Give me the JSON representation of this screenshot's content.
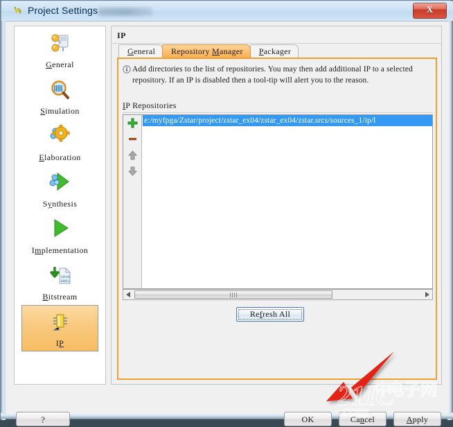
{
  "window": {
    "title": "Project Settings",
    "icon": "vivado-logo-icon",
    "close_label": "X"
  },
  "sidebar": {
    "items": [
      {
        "label_pre": "",
        "label_u": "G",
        "label_post": "eneral",
        "label": "General",
        "icon": "general-icon",
        "selected": false
      },
      {
        "label_pre": "",
        "label_u": "S",
        "label_post": "imulation",
        "label": "Simulation",
        "icon": "simulation-icon",
        "selected": false
      },
      {
        "label_pre": "",
        "label_u": "E",
        "label_post": "laboration",
        "label": "Elaboration",
        "icon": "elaboration-icon",
        "selected": false
      },
      {
        "label_pre": "S",
        "label_u": "y",
        "label_post": "nthesis",
        "label": "Synthesis",
        "icon": "synthesis-icon",
        "selected": false
      },
      {
        "label_pre": "I",
        "label_u": "m",
        "label_post": "plementation",
        "label": "Implementation",
        "icon": "implementation-icon",
        "selected": false
      },
      {
        "label_pre": "",
        "label_u": "B",
        "label_post": "itstream",
        "label": "Bitstream",
        "icon": "bitstream-icon",
        "selected": false
      },
      {
        "label_pre": "I",
        "label_u": "P",
        "label_post": "",
        "label": "IP",
        "icon": "ip-chip-icon",
        "selected": true
      }
    ],
    "help_label": "?"
  },
  "panel": {
    "title": "IP",
    "tabs": [
      {
        "pre": "",
        "u": "G",
        "post": "eneral",
        "label": "General",
        "active": false
      },
      {
        "pre": "Repository ",
        "u": "M",
        "post": "anager",
        "label": "Repository Manager",
        "active": true
      },
      {
        "pre": "",
        "u": "P",
        "post": "ackager",
        "label": "Packager",
        "active": false
      }
    ],
    "info_icon": "info-icon",
    "info_text": "Add directories to the list of repositories. You may then add additional IP to a selected repository. If an IP is disabled then a tool-tip will alert you to the reason.",
    "repos_label_u": "I",
    "repos_label_post": "P Repositories",
    "repos_label": "IP Repositories",
    "list_toolbar": [
      {
        "name": "add-repository-button",
        "icon": "plus-icon"
      },
      {
        "name": "remove-repository-button",
        "icon": "minus-icon"
      },
      {
        "name": "move-up-button",
        "icon": "arrow-up-icon"
      },
      {
        "name": "move-down-button",
        "icon": "arrow-down-icon"
      }
    ],
    "repositories": [
      {
        "path": "e:/myfpga/Zstar/project/zstar_ex04/zstar_ex04/zstar.srcs/sources_1/ip/l",
        "selected": true
      }
    ],
    "refresh_pre": "Re",
    "refresh_u": "f",
    "refresh_post": "resh All",
    "refresh_label": "Refresh All"
  },
  "footer": {
    "ok_label": "OK",
    "cancel_pre": "Ca",
    "cancel_u": "n",
    "cancel_post": "cel",
    "cancel_label": "Cancel",
    "apply_u": "A",
    "apply_post": "pply",
    "apply_label": "Apply"
  },
  "annotation": {
    "arrow": "red-arrow-pointing-to-ok",
    "watermark": "21ic-com-watermark"
  },
  "colors": {
    "accent_orange": "#f0a030",
    "tab_active": "#fabf70",
    "selection_blue": "#3399f3",
    "close_red": "#c63c29",
    "annotation_red": "#e52213"
  }
}
